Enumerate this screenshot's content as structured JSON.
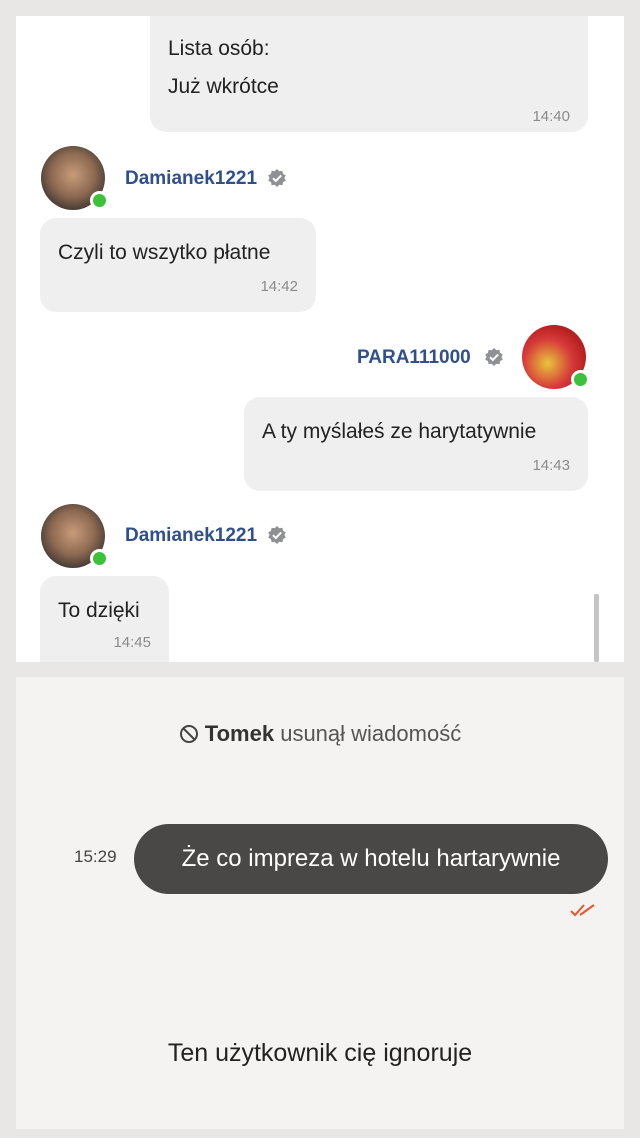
{
  "messages": [
    {
      "id": "m1",
      "text_line1": "Lista osób:",
      "text_line2": "Już wkrótce",
      "time": "14:40"
    },
    {
      "id": "m2",
      "author": "Damianek1221",
      "text": "Czyli to wszytko płatne",
      "time": "14:42"
    },
    {
      "id": "m3",
      "author": "PARA111000",
      "text": "A ty myślałeś ze harytatywnie",
      "time": "14:43"
    },
    {
      "id": "m4",
      "author": "Damianek1221",
      "text": "To dzięki",
      "time": "14:45"
    }
  ],
  "lower": {
    "deleted_user": "Tomek",
    "deleted_text": "usunął wiadomość",
    "sent_time": "15:29",
    "sent_text": "Że co impreza w hotelu hartarywnie",
    "ignore_text": "Ten użytkownik cię ignoruje"
  },
  "colors": {
    "username": "#2f4f8f",
    "online": "#3cc13b",
    "read_ticks": "#e8572a",
    "dark_bubble": "#4a4846"
  },
  "icons": {
    "verified": "verified-badge-icon",
    "deleted": "blocked-circle-icon",
    "read": "double-check-icon"
  }
}
